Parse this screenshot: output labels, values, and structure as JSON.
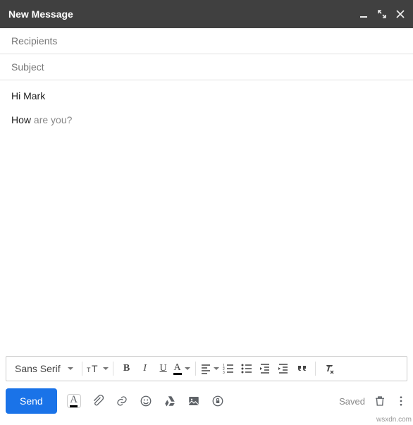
{
  "header": {
    "title": "New Message"
  },
  "fields": {
    "recipients_placeholder": "Recipients",
    "subject_placeholder": "Subject"
  },
  "body": {
    "line1": "Hi Mark",
    "line2_plain": "How ",
    "line2_ghost": "are you?"
  },
  "format_toolbar": {
    "font": "Sans Serif",
    "bold": "B",
    "italic": "I",
    "underline": "U",
    "text_color": "A"
  },
  "bottom": {
    "send": "Send",
    "format_A": "A",
    "saved": "Saved"
  },
  "watermark": "wsxdn.com"
}
